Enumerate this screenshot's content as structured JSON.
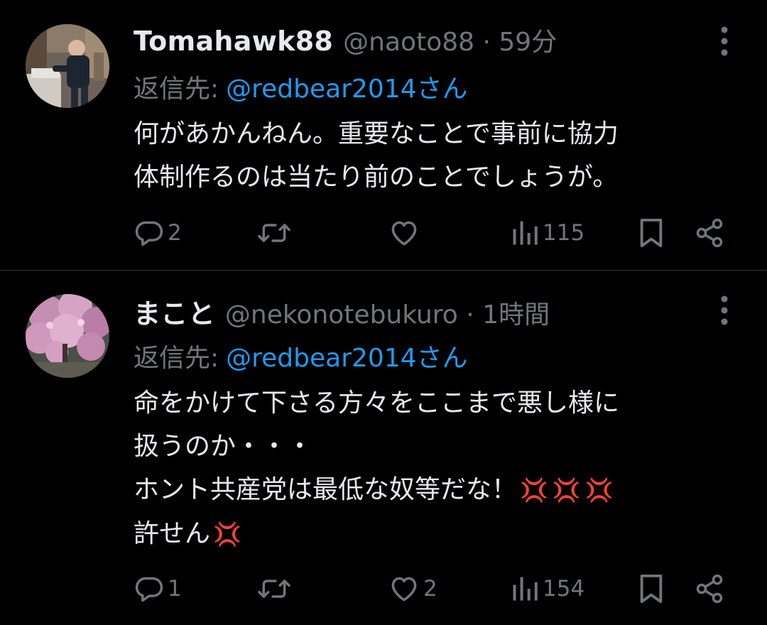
{
  "tweets": [
    {
      "display_name": "Tomahawk88",
      "handle": "@naoto88",
      "separator": "·",
      "time": "59分",
      "reply_prefix": "返信先:",
      "reply_to": "@redbear2014さん",
      "lines": [
        "何があかんねん。重要なことで事前に協力",
        "体制作るのは当たり前のことでしょうが。"
      ],
      "replies": "2",
      "retweets": "",
      "likes": "",
      "views": "115"
    },
    {
      "display_name": "まこと",
      "handle": "@nekonotebukuro",
      "separator": "·",
      "time": "1時間",
      "reply_prefix": "返信先:",
      "reply_to": "@redbear2014さん",
      "lines": [
        "命をかけて下さる方々をここまで悪し様に",
        "扱うのか・・・",
        "ホント共産党は最低な奴等だな！",
        "許せん"
      ],
      "emoji_line3": "💢💢💢",
      "emoji_line4": "💢",
      "replies": "1",
      "retweets": "",
      "likes": "2",
      "views": "154"
    }
  ],
  "icons": {
    "reply": "reply-icon",
    "retweet": "retweet-icon",
    "like": "heart-icon",
    "views": "views-chart-icon",
    "bookmark": "bookmark-icon",
    "share": "share-icon",
    "more": "more-vertical-icon"
  },
  "colors": {
    "background": "#000000",
    "text": "#e7e9ea",
    "secondary": "#71767b",
    "link": "#1d9bf0",
    "divider": "#2f3336"
  }
}
